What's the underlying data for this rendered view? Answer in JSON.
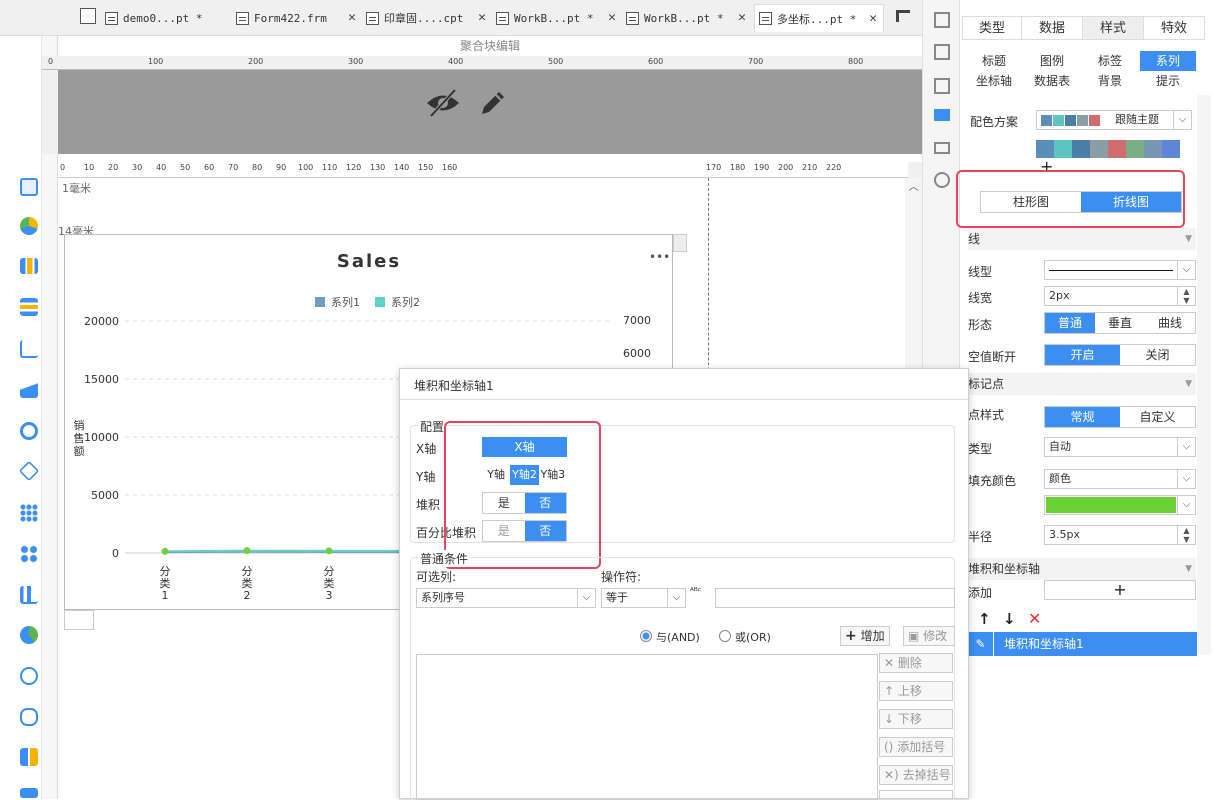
{
  "tabs": [
    {
      "label": "demo0...pt *"
    },
    {
      "label": "Form422.frm"
    },
    {
      "label": "印章固....cpt"
    },
    {
      "label": "WorkB...pt *"
    },
    {
      "label": "WorkB...pt *"
    },
    {
      "label": "多坐标...pt *"
    }
  ],
  "editor": {
    "block_label": "聚合块编辑",
    "upper_ruler": [
      "0",
      "100",
      "200",
      "300",
      "400",
      "500",
      "600",
      "700",
      "800"
    ],
    "lower_ruler": [
      "0",
      "10",
      "20",
      "30",
      "40",
      "50",
      "60",
      "70",
      "80",
      "90",
      "100",
      "110",
      "120",
      "130",
      "140",
      "150",
      "160",
      "170",
      "180",
      "190",
      "200",
      "210",
      "220"
    ],
    "margin_top": "1毫米",
    "margin_chart": "14毫米"
  },
  "chart_data": {
    "type": "line",
    "title": "Sales",
    "ylabel": "销售额",
    "categories": [
      "分类1",
      "分类2",
      "分类3"
    ],
    "left_axis": {
      "ticks": [
        "20000",
        "15000",
        "10000",
        "5000",
        "0"
      ],
      "ylim": [
        0,
        20000
      ]
    },
    "right_axis": {
      "ticks": [
        "7000",
        "6000"
      ]
    },
    "series": [
      {
        "name": "系列1",
        "color": "#6e9cc2",
        "values": [
          80,
          120,
          100
        ]
      },
      {
        "name": "系列2",
        "color": "#62d0c4",
        "values": [
          140,
          200,
          180
        ]
      }
    ],
    "marker_color": "#6fd23a",
    "legend_position": "top",
    "grid": true
  },
  "right_panel": {
    "top_tabs": [
      "类型",
      "数据",
      "样式",
      "特效"
    ],
    "sub_tabs": [
      "标题",
      "图例",
      "标签",
      "系列",
      "坐标轴",
      "数据表",
      "背景",
      "提示"
    ],
    "color_scheme": {
      "label": "配色方案",
      "value": "跟随主题",
      "swatches": [
        "#5b8fb9",
        "#5ec4c0",
        "#4a7ea8",
        "#8b9ea7",
        "#d16d6d",
        "#7cae86",
        "#7a95b5",
        "#5f86d8"
      ]
    },
    "chart_type": {
      "options": [
        "柱形图",
        "折线图"
      ],
      "selected": "折线图"
    },
    "line_section": "线",
    "line_type_label": "线型",
    "line_width": {
      "label": "线宽",
      "value": "2px"
    },
    "shape": {
      "label": "形态",
      "options": [
        "普通",
        "垂直",
        "曲线"
      ],
      "selected": "普通"
    },
    "null_break": {
      "label": "空值断开",
      "options": [
        "开启",
        "关闭"
      ],
      "selected": "开启"
    },
    "marker_section": "标记点",
    "point_style": {
      "label": "点样式",
      "options": [
        "常规",
        "自定义"
      ],
      "selected": "常规"
    },
    "marker_type": {
      "label": "类型",
      "value": "自动"
    },
    "fill_color": {
      "label": "填充颜色",
      "value": "颜色",
      "swatch": "#6ad132"
    },
    "radius": {
      "label": "半径",
      "value": "3.5px"
    },
    "stack_section": "堆积和坐标轴",
    "add_label": "添加",
    "stack_item": "堆积和坐标轴1"
  },
  "dialog": {
    "title": "堆积和坐标轴1",
    "config_label": "配置",
    "x_axis": {
      "label": "X轴",
      "value": "X轴"
    },
    "y_axis": {
      "label": "Y轴",
      "options": [
        "Y轴",
        "Y轴2",
        "Y轴3"
      ],
      "selected": "Y轴2"
    },
    "stack": {
      "label": "堆积",
      "options": [
        "是",
        "否"
      ],
      "selected": "否"
    },
    "percent_stack": {
      "label": "百分比堆积",
      "options": [
        "是",
        "否"
      ],
      "selected": "否"
    },
    "condition_label": "普通条件",
    "column_label": "可选列:",
    "column_value": "系列序号",
    "operator_label": "操作符:",
    "operator_value": "等于",
    "and_label": "与(AND)",
    "or_label": "或(OR)",
    "add_btn": "增加",
    "modify_btn": "修改",
    "delete_btn": "删除",
    "up_btn": "上移",
    "down_btn": "下移",
    "add_paren_btn": "添加括号",
    "remove_paren_btn": "去掉括号"
  }
}
